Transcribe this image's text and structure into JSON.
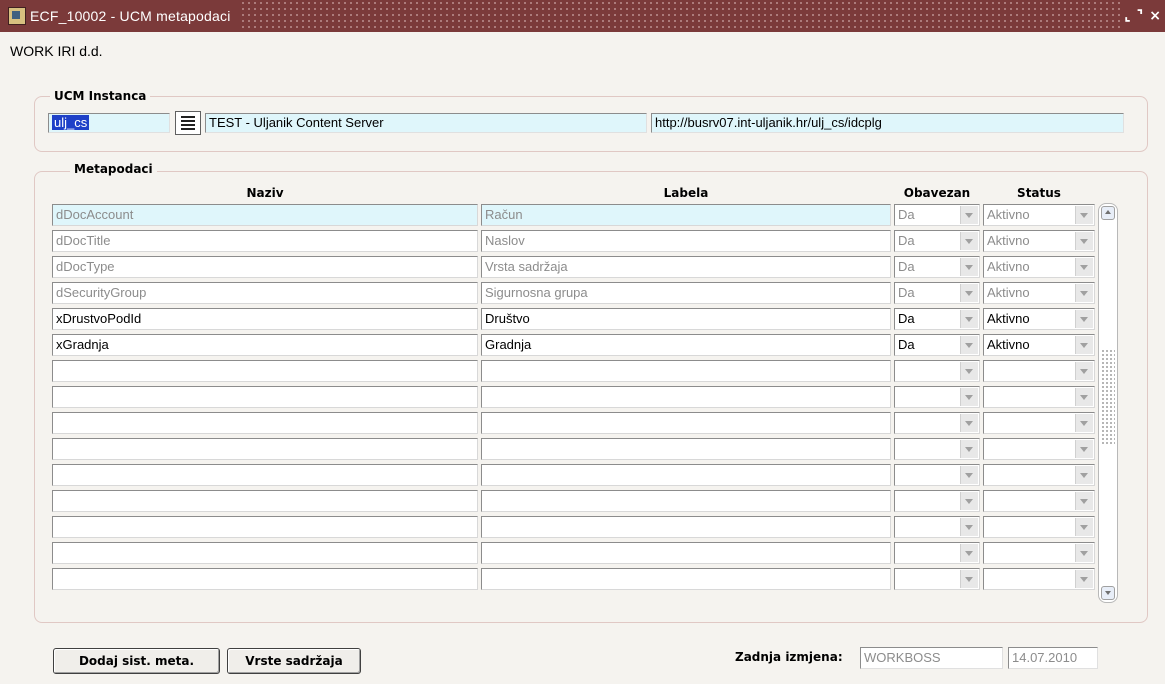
{
  "window": {
    "title": "ECF_10002 - UCM metapodaci",
    "controls": [
      "⌞",
      "⌝",
      "×"
    ]
  },
  "company": "WORK IRI d.d.",
  "ucm": {
    "group_label": "UCM Instanca",
    "instance": "ulj_cs",
    "name": "TEST - Uljanik Content Server",
    "url": "http://busrv07.int-uljanik.hr/ulj_cs/idcplg",
    "lov_icon": "list-icon"
  },
  "metapodaci": {
    "group_label": "Metapodaci",
    "columns": {
      "naziv": "Naziv",
      "labela": "Labela",
      "obavezan": "Obavezan",
      "status": "Status"
    },
    "rows": [
      {
        "naziv": "dDocAccount",
        "labela": "Račun",
        "obavezan": "Da",
        "status": "Aktivno"
      },
      {
        "naziv": "dDocTitle",
        "labela": "Naslov",
        "obavezan": "Da",
        "status": "Aktivno"
      },
      {
        "naziv": "dDocType",
        "labela": "Vrsta sadržaja",
        "obavezan": "Da",
        "status": "Aktivno"
      },
      {
        "naziv": "dSecurityGroup",
        "labela": "Sigurnosna grupa",
        "obavezan": "Da",
        "status": "Aktivno"
      },
      {
        "naziv": "xDrustvoPodId",
        "labela": "Društvo",
        "obavezan": "Da",
        "status": "Aktivno"
      },
      {
        "naziv": "xGradnja",
        "labela": "Gradnja",
        "obavezan": "Da",
        "status": "Aktivno"
      },
      {
        "naziv": "",
        "labela": "",
        "obavezan": "",
        "status": ""
      },
      {
        "naziv": "",
        "labela": "",
        "obavezan": "",
        "status": ""
      },
      {
        "naziv": "",
        "labela": "",
        "obavezan": "",
        "status": ""
      },
      {
        "naziv": "",
        "labela": "",
        "obavezan": "",
        "status": ""
      },
      {
        "naziv": "",
        "labela": "",
        "obavezan": "",
        "status": ""
      },
      {
        "naziv": "",
        "labela": "",
        "obavezan": "",
        "status": ""
      },
      {
        "naziv": "",
        "labela": "",
        "obavezan": "",
        "status": ""
      },
      {
        "naziv": "",
        "labela": "",
        "obavezan": "",
        "status": ""
      },
      {
        "naziv": "",
        "labela": "",
        "obavezan": "",
        "status": ""
      }
    ]
  },
  "footer": {
    "btn_dodaj": "Dodaj sist. meta.",
    "btn_vrste": "Vrste sadržaja",
    "zadnja_label": "Zadnja izmjena:",
    "zadnja_user": "WORKBOSS",
    "zadnja_date": "14.07.2010"
  }
}
